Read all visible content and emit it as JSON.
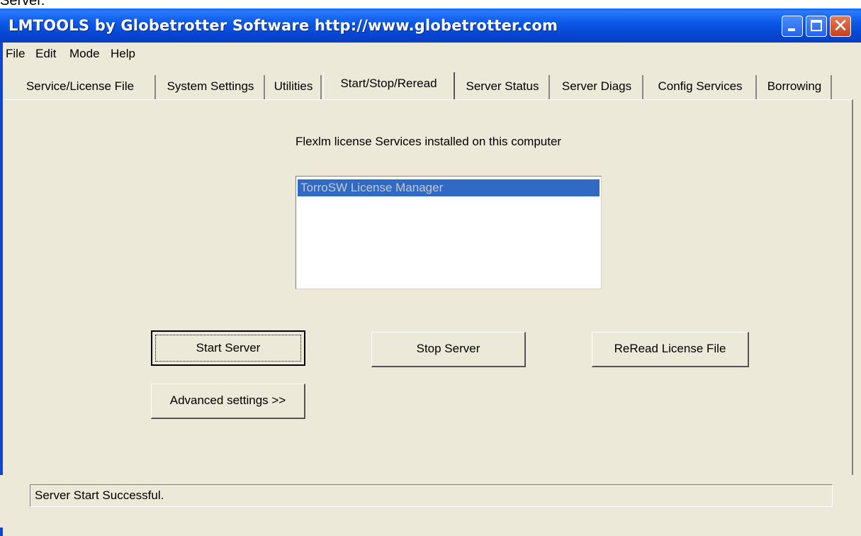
{
  "page": {
    "top_caption": "Server."
  },
  "window": {
    "title": "LMTOOLS by Globetrotter Software http://www.globetrotter.com"
  },
  "menu": {
    "items": [
      "File",
      "Edit",
      "Mode",
      "Help"
    ]
  },
  "tabs": {
    "items": [
      "Service/License File",
      "System Settings",
      "Utilities",
      "Start/Stop/Reread",
      "Server Status",
      "Server Diags",
      "Config Services",
      "Borrowing"
    ],
    "active": "Start/Stop/Reread"
  },
  "services": {
    "label": "Flexlm license Services installed on this computer",
    "list": [
      "TorroSW License Manager"
    ],
    "selected": "TorroSW License Manager"
  },
  "buttons": {
    "start": "Start Server",
    "stop": "Stop Server",
    "reread": "ReRead License File",
    "advanced": "Advanced settings >>"
  },
  "status": {
    "text": "Server Start Successful."
  },
  "colors": {
    "titlebar": "#0546d4",
    "selection": "#316ac5",
    "face": "#ece9d8"
  },
  "icons": [
    "minimize-icon",
    "maximize-icon",
    "close-icon"
  ]
}
